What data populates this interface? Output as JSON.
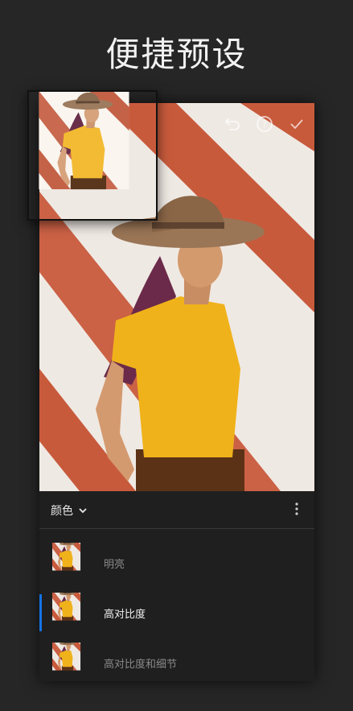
{
  "headline": "便捷预设",
  "toolbar": {
    "undo_icon": "undo-icon",
    "help_icon": "help-icon",
    "confirm_icon": "checkmark-icon"
  },
  "panel": {
    "category": "颜色",
    "presets": [
      {
        "label": "明亮",
        "selected": false
      },
      {
        "label": "高对比度",
        "selected": true
      },
      {
        "label": "高对比度和细节",
        "selected": false
      }
    ]
  },
  "colors": {
    "accent": "#1473e6",
    "stripe_orange": "#c85a3c",
    "wall_white": "#efe9e3",
    "shirt_yellow": "#f0b21a"
  }
}
